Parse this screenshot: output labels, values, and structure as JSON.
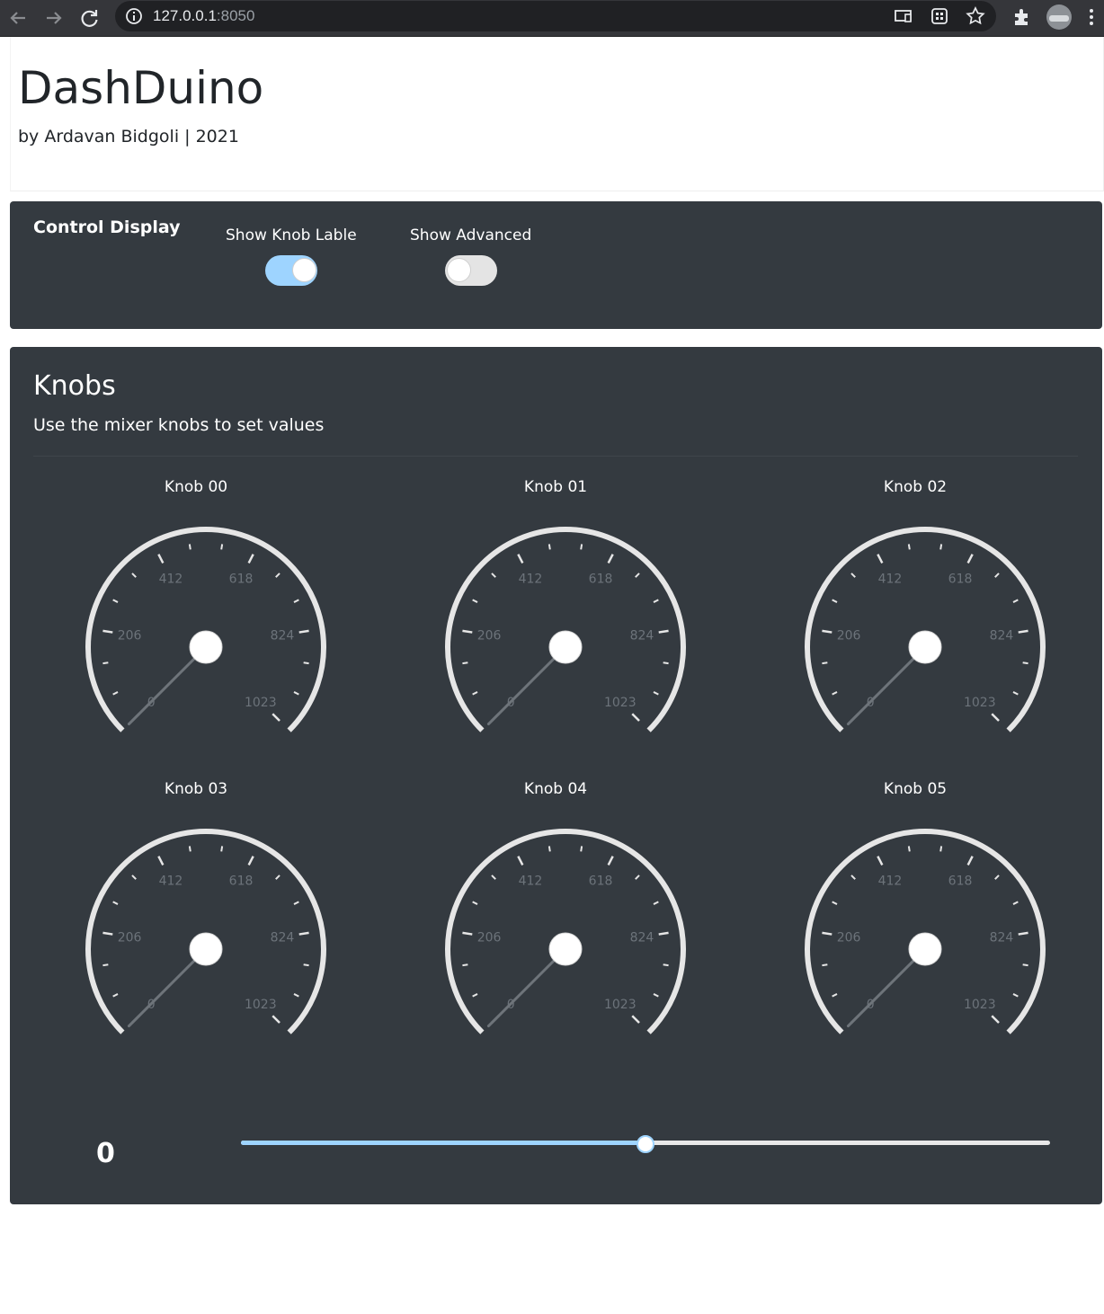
{
  "browser": {
    "url_host": "127.0.0.1",
    "url_port": ":8050",
    "icons": [
      "back-icon",
      "forward-icon",
      "reload-icon",
      "info-icon",
      "cast-icon",
      "qr-icon",
      "star-icon",
      "extensions-icon",
      "profile-avatar",
      "menu-icon"
    ]
  },
  "header": {
    "title": "DashDuino",
    "subtitle": "by Ardavan Bidgoli | 2021"
  },
  "control_display": {
    "title": "Control Display",
    "toggles": [
      {
        "label": "Show Knob Lable",
        "on": true
      },
      {
        "label": "Show Advanced",
        "on": false
      }
    ]
  },
  "knobs_section": {
    "title": "Knobs",
    "subtitle": "Use the mixer knobs to set values",
    "scale_labels": [
      "0",
      "206",
      "412",
      "618",
      "824",
      "1023"
    ],
    "min": 0,
    "max": 1023,
    "knobs": [
      {
        "label": "Knob 00",
        "value": 0
      },
      {
        "label": "Knob 01",
        "value": 0
      },
      {
        "label": "Knob 02",
        "value": 0
      },
      {
        "label": "Knob 03",
        "value": 0
      },
      {
        "label": "Knob 04",
        "value": 0
      },
      {
        "label": "Knob 05",
        "value": 0
      }
    ]
  },
  "readout": {
    "value": "0"
  },
  "slider": {
    "fraction": 0.5
  },
  "colors": {
    "card_bg": "#343a40",
    "accent": "#9ed4ff",
    "gauge_ring": "#e6e6e6",
    "gauge_label": "#6c737a"
  }
}
